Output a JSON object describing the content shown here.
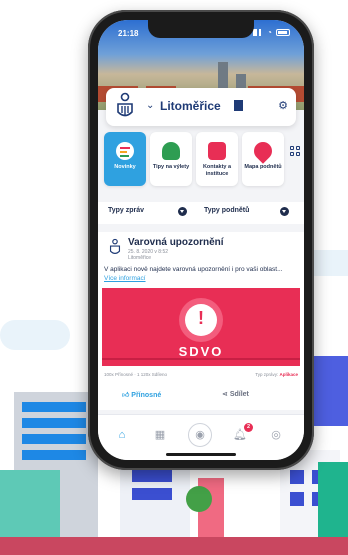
{
  "status_bar": {
    "time": "21:18"
  },
  "header": {
    "city": "Litoměřice"
  },
  "tiles": [
    {
      "label": "Novinky",
      "color": "#e82e55"
    },
    {
      "label": "Tipy na výlety",
      "color": "#2e9d52"
    },
    {
      "label": "Kontakty a instituce",
      "color": "#e82e55"
    },
    {
      "label": "Mapa podnětů",
      "color": "#e82e55"
    }
  ],
  "filters": {
    "left": "Typy zpráv",
    "right": "Typy podnětů"
  },
  "post": {
    "title": "Varovná upozornění",
    "date": "25. 8. 2020 v 8:52",
    "source": "Litoměřice",
    "body": "V aplikaci nově najdete varovná upozornění i pro vaši oblast... ",
    "more_link": "Více informací",
    "banner_label": "SDVO",
    "stats": "100x Přínosné · 1 120x Sdíleno",
    "type_label": "Typ zprávy:",
    "type_value": "Aplikace",
    "like_label": "Přínosné",
    "share_label": "Sdílet"
  },
  "tabbar": {
    "notifications_count": "2"
  },
  "colors": {
    "accent": "#2fa1e0",
    "alert": "#e82e55",
    "navy": "#1f3b76"
  }
}
